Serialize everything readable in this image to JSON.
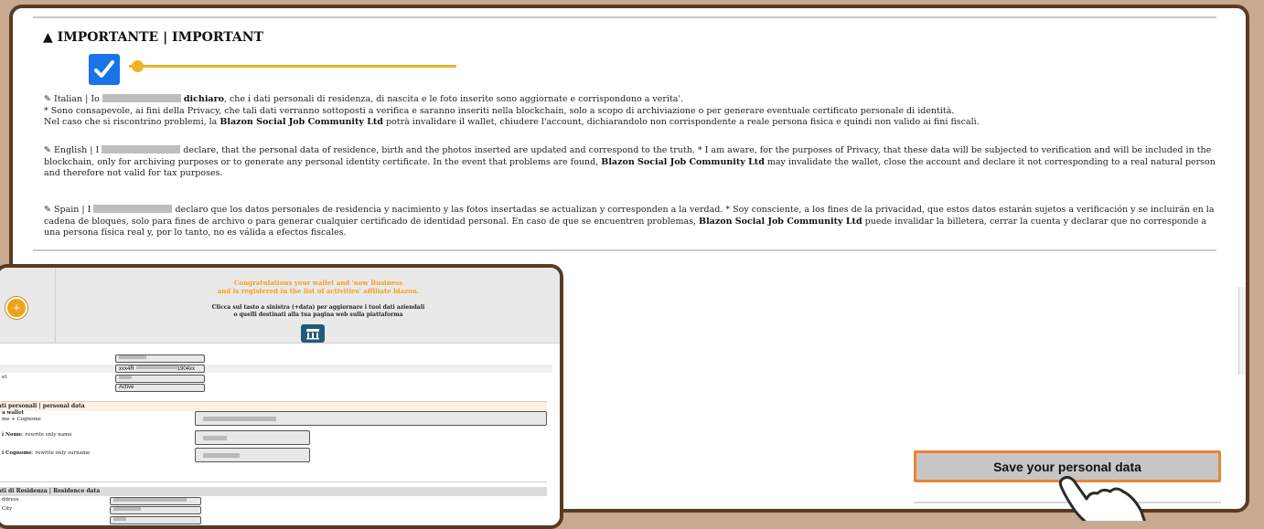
{
  "important": {
    "title": "IMPORTANTE | IMPORTANT",
    "checkbox_checked": true
  },
  "paragraphs": {
    "italian": {
      "lead": "Italian | Io",
      "bold1": "dichiaro",
      "text1": ", che i dati personali di residenza, di nascita e le foto inserite sono aggiornate e corrispondono a verita'.",
      "text2": "* Sono consapevole, ai fini della Privacy, che tali dati verranno sottoposti a verifica e saranno inseriti nella blockchain, solo a scopo di archiviazione o per generare eventuale certificato personale di identità.",
      "text3a": "Nel caso che si riscontrino problemi, la",
      "company": "Blazon Social Job Community Ltd",
      "text3b": "potrà invalidare il wallet, chiudere l'account, dichiarandolo non corrispondente a reale persona fisica e quindi non valido ai fini fiscali."
    },
    "english": {
      "lead": "English | I",
      "text1": "declare, that the personal data of residence, birth and the photos inserted are updated and correspond to the truth. * I am aware, for the purposes of Privacy, that these data will be subjected to verification and will be included in the blockchain, only for archiving purposes or to generate any personal identity certificate. In the event that problems are found,",
      "company": "Blazon Social Job Community Ltd",
      "text2": "may invalidate the wallet, close the account and declare it not corresponding to a real natural person and therefore not valid for tax purposes."
    },
    "spain": {
      "lead": "Spain | I",
      "text1": "declaro que los datos personales de residencia y nacimiento y las fotos insertadas se actualizan y corresponden a la verdad. * Soy consciente, a los fines de la privacidad, que estos datos estarán sujetos a verificación y se incluirán en la cadena de bloques, solo para fines de archivo o para generar cualquier certificado de identidad personal. En caso de que se encuentren problemas,",
      "company": "Blazon Social Job Community Ltd",
      "text2": "puede invalidar la billetera, cerrar la cuenta y declarar que no corresponde a una persona física real y, por lo tanto, no es válida a efectos fiscales."
    }
  },
  "save_button": {
    "label": "Save your personal data"
  },
  "inset": {
    "plus_icon": "+",
    "congrats_line1": "Congratulations your wallet and 'now Business",
    "congrats_line2": "and is registered in the list of activities' affiliate blazon.",
    "clicca_line1": "Clicca sul tasto a sinistra (+data) per aggiornare i tuoi dati aziendali",
    "clicca_line2": "o quelli destinati alla tua pagina web sulla piattaforma",
    "wallet_id": "xxx4R",
    "wallet_id_suffix": "1904xx",
    "status": "Active",
    "label_wallet": "et",
    "personal_section": "ati personali | personal data",
    "label_wallet_name": "a wallet",
    "label_name_surname": "me + Cognome",
    "label_nome": "i Nome",
    "label_nome_hint": ": rewrite only name",
    "label_cognome": "i Cognome",
    "label_cognome_hint": ": rewrite only surname",
    "residence_section": "ati di Residenza | Residence data",
    "label_address": "ddress",
    "label_city": "City"
  }
}
